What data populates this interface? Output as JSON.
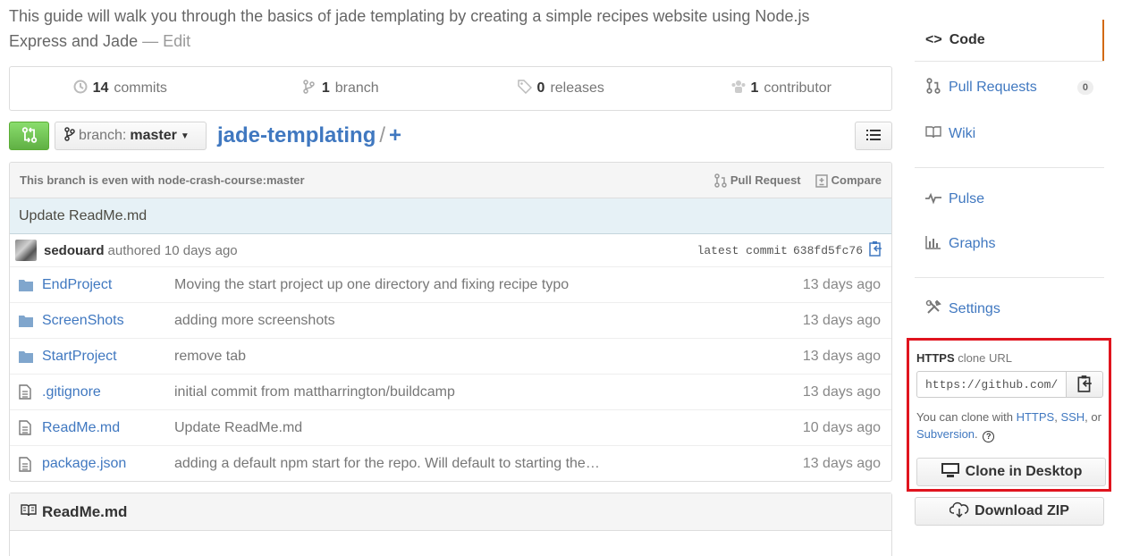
{
  "repo": {
    "description": "This guide will walk you through the basics of jade templating by creating a simple recipes website using Node.js Express and Jade",
    "edit_sep": " — ",
    "edit_label": "Edit",
    "name": "jade-templating",
    "path_sep": "/",
    "new_file": "+"
  },
  "summary": {
    "commits_count": "14",
    "commits_label": "commits",
    "branch_count": "1",
    "branch_label": "branch",
    "releases_count": "0",
    "releases_label": "releases",
    "contributor_count": "1",
    "contributor_label": "contributor"
  },
  "toolbar": {
    "branch_prefix": "branch:",
    "branch_name": "master"
  },
  "compare_bar": {
    "status": "This branch is even with node-crash-course:master",
    "pull_request": "Pull Request",
    "compare": "Compare"
  },
  "last_commit": {
    "message": "Update ReadMe.md",
    "author": "sedouard",
    "authored": "authored 10 days ago",
    "sha_label": "latest commit",
    "sha": "638fd5fc76"
  },
  "files": [
    {
      "type": "dir",
      "name": "EndProject",
      "message": "Moving the start project up one directory and fixing recipe typo",
      "age": "13 days ago"
    },
    {
      "type": "dir",
      "name": "ScreenShots",
      "message": "adding more screenshots",
      "age": "13 days ago"
    },
    {
      "type": "dir",
      "name": "StartProject",
      "message": "remove tab",
      "age": "13 days ago"
    },
    {
      "type": "file",
      "name": ".gitignore",
      "message": "initial commit from mattharrington/buildcamp",
      "age": "13 days ago"
    },
    {
      "type": "file",
      "name": "ReadMe.md",
      "message": "Update ReadMe.md",
      "age": "10 days ago"
    },
    {
      "type": "file",
      "name": "package.json",
      "message": "adding a default npm start for the repo. Will default to starting the…",
      "age": "13 days ago"
    }
  ],
  "readme": {
    "title": "ReadMe.md"
  },
  "nav": {
    "code": "Code",
    "pull_requests": "Pull Requests",
    "pull_requests_count": "0",
    "wiki": "Wiki",
    "pulse": "Pulse",
    "graphs": "Graphs",
    "settings": "Settings"
  },
  "clone": {
    "protocol": "HTTPS",
    "label": "clone URL",
    "url": "https://github.com/r",
    "help_prefix": "You can clone with",
    "https": "HTTPS",
    "comma": ",",
    "ssh": "SSH",
    "or": ", or",
    "subversion": "Subversion",
    "period": ".",
    "help_icon": "?",
    "desktop_button": "Clone in Desktop",
    "zip_button": "Download ZIP"
  },
  "colors": {
    "link": "#4078c0",
    "highlight_box": "#e0141e",
    "compare_green": "#6cc644",
    "selected_nav": "#d26911"
  }
}
